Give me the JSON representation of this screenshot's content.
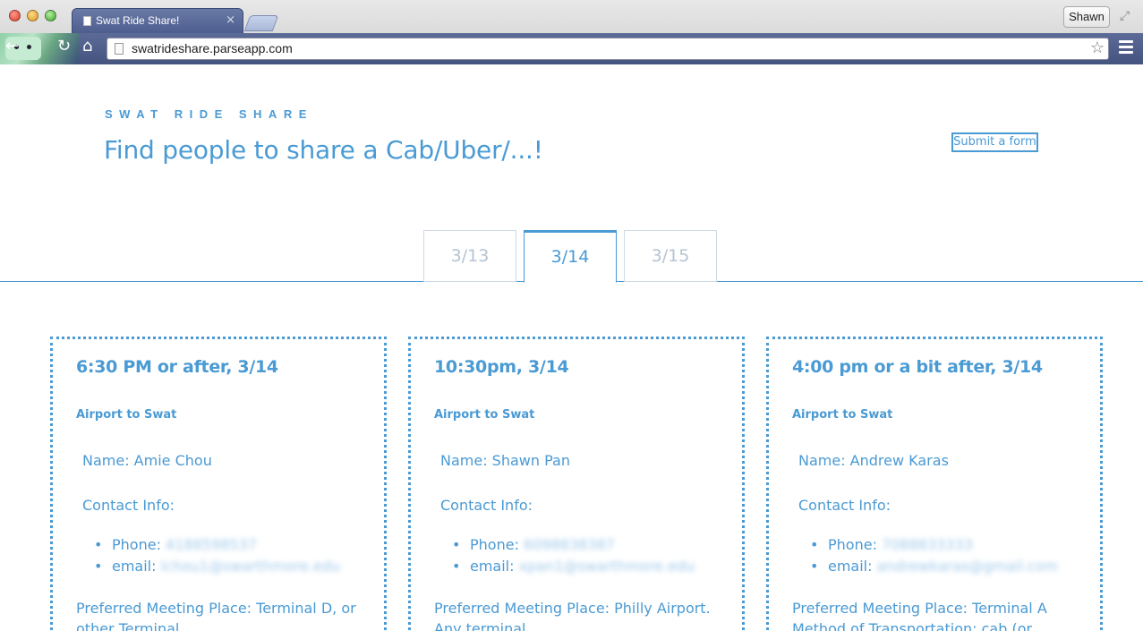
{
  "browser": {
    "tab_title": "Swat Ride Share!",
    "tab_close": "×",
    "profile_name": "Shawn",
    "url": "swatrideshare.parseapp.com"
  },
  "header": {
    "brand": "SWAT RIDE SHARE",
    "headline": "Find people to share a Cab/Uber/...!",
    "submit_label": "Submit a form"
  },
  "date_tabs": [
    {
      "label": "3/13",
      "active": false
    },
    {
      "label": "3/14",
      "active": true
    },
    {
      "label": "3/15",
      "active": false
    }
  ],
  "cards": [
    {
      "time": "6:30 PM or after, 3/14",
      "direction": "Airport to Swat",
      "name_line": "Name: Amie Chou",
      "contact_label": "Contact Info:",
      "phone_label": "Phone:",
      "phone_value": "4188598537",
      "email_label": "email:",
      "email_value": "lchou1@swarthmore.edu",
      "meeting": "Preferred Meeting Place: Terminal D, or other Terminal"
    },
    {
      "time": "10:30pm, 3/14",
      "direction": "Airport to Swat",
      "name_line": "Name: Shawn Pan",
      "contact_label": "Contact Info:",
      "phone_label": "Phone:",
      "phone_value": "6098838387",
      "email_label": "email:",
      "email_value": "xpan1@swarthmore.edu",
      "meeting": "Preferred Meeting Place: Philly Airport. Any terminal"
    },
    {
      "time": "4:00 pm or a bit after, 3/14",
      "direction": "Airport to Swat",
      "name_line": "Name: Andrew Karas",
      "contact_label": "Contact Info:",
      "phone_label": "Phone:",
      "phone_value": "7088833333",
      "email_label": "email:",
      "email_value": "andrewkaras@gmail.com",
      "meeting": "Preferred Meeting Place: Terminal A Method of Transportation: cab (or"
    }
  ],
  "colors": {
    "accent": "#4a9ad4",
    "inactive_tab_text": "#b4c3d3"
  }
}
